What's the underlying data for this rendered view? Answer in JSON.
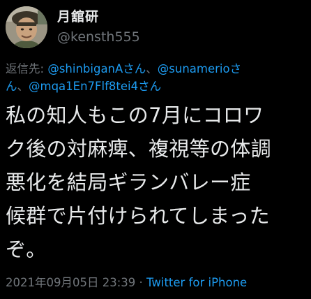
{
  "user": {
    "display_name": "月舘研",
    "handle": "@kensth555"
  },
  "reply": {
    "prefix": "返信先: ",
    "mention_1": "@shinbiganAさん",
    "sep_1": "、",
    "mention_2a": "@sunamerioさ",
    "mention_2b": "ん",
    "sep_2": "、",
    "mention_3": "@mqa1En7Flf8tei4さん"
  },
  "tweet": {
    "lines": [
      "私の知人もこの7月にコロワ",
      "ク後の対麻痺、複視等の体調",
      "悪化を結局ギランバレー症",
      "候群で片付けられてしまった",
      "ぞ。"
    ]
  },
  "meta": {
    "timestamp": "2021年09月05日 23:39",
    "separator": " · ",
    "source": "Twitter for iPhone"
  },
  "colors": {
    "background": "#000000",
    "text": "#e7e9ea",
    "secondary": "#71767b",
    "accent": "#1d9bf0"
  }
}
